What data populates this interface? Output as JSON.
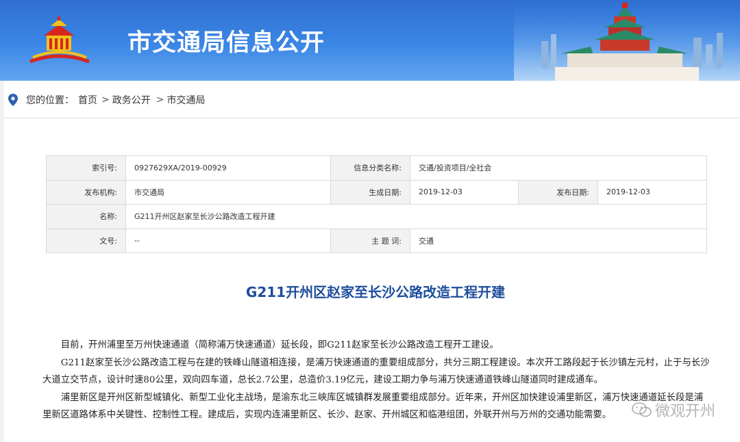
{
  "banner": {
    "title": "市交通局信息公开"
  },
  "breadcrumb": {
    "prefix": "您的位置：",
    "items": [
      "首页",
      "政务公开",
      "市交通局"
    ],
    "separator": ">"
  },
  "meta_table": {
    "index_label": "索引号:",
    "index_value": "0927629XA/2019-00929",
    "category_label": "信息分类名称:",
    "category_value": "交通/投资项目/全社会",
    "publisher_label": "发布机构:",
    "publisher_value": "市交通局",
    "generated_label": "生成日期:",
    "generated_value": "2019-12-03",
    "published_label": "发布日期:",
    "published_value": "2019-12-03",
    "name_label": "名称:",
    "name_value": "G211开州区赵家至长沙公路改造工程开建",
    "docno_label": "文号:",
    "docno_value": "--",
    "subject_label": "主 题 词:",
    "subject_value": "交通"
  },
  "article": {
    "title": "G211开州区赵家至长沙公路改造工程开建",
    "paragraphs": [
      "目前，开州浦里至万州快速通道（简称浦万快速通道）延长段，即G211赵家至长沙公路改造工程开工建设。",
      "G211赵家至长沙公路改造工程与在建的铁峰山隧道相连接，是浦万快速通道的重要组成部分，共分三期工程建设。本次开工路段起于长沙镇左元村，止于与长沙大道立交节点，设计时速80公里，双向四车道，总长2.7公里，总造价3.19亿元，建设工期力争与浦万快速通道铁峰山隧道同时建成通车。",
      "浦里新区是开州区新型城镇化、新型工业化主战场，是渝东北三峡库区城镇群发展重要组成部分。近年来，开州区加快建设浦里新区，浦万快速通道延长段是浦里新区道路体系中关键性、控制性工程。建成后，实现内连浦里新区、长沙、赵家、开州城区和临港组团，外联开州与万州的交通功能需要。"
    ]
  },
  "watermark": {
    "text": "微观开州",
    "icon": "wechat-icon"
  },
  "colors": {
    "banner_top": "#2f6fd1",
    "banner_bottom": "#62a6ef",
    "title_blue": "#1d4d9c",
    "label_bg": "#f2f2f2",
    "table_border": "#d9d9d9"
  }
}
